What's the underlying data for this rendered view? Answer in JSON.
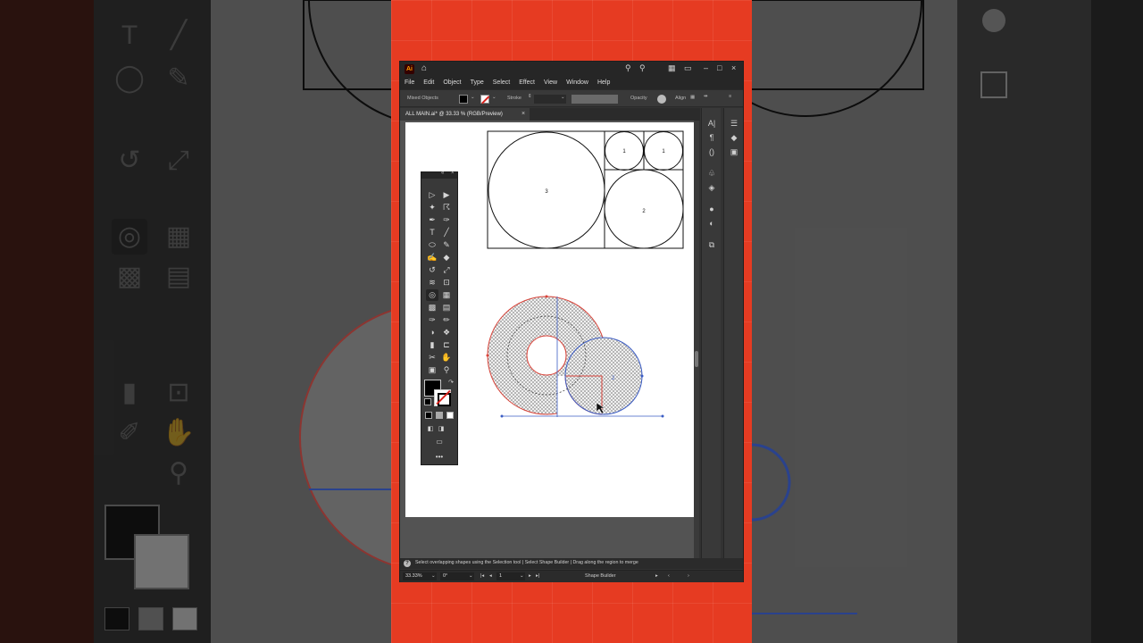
{
  "app": {
    "logo_text": "Ai",
    "menus": [
      "File",
      "Edit",
      "Object",
      "Type",
      "Select",
      "Effect",
      "View",
      "Window",
      "Help"
    ]
  },
  "control_bar": {
    "selection_label": "Mixed Objects",
    "stroke_label": "Stroke",
    "opacity_label": "Opacity",
    "align_label": "Align"
  },
  "document": {
    "tab_title": "ALL MAIN.ai* @ 33.33 % (RGB/Preview)",
    "close_glyph": "×"
  },
  "artwork": {
    "big_circle_label": "3",
    "small_circle_left_label": "1",
    "small_circle_right_label": "1",
    "medium_circle_label": "2",
    "shape_circle_label": "2"
  },
  "status": {
    "help_glyph": "?",
    "hint": "Select overlapping shapes using the Selection tool  |  Select Shape Builder  |  Drag along the region to merge"
  },
  "bottom_bar": {
    "zoom": "33.33%",
    "rotation": "0°",
    "artboard_number": "1",
    "tool_name": "Shape Builder"
  },
  "colors": {
    "background_accent": "#e63b22",
    "selection_red": "#d9443a",
    "selection_blue": "#3b5cc4"
  }
}
